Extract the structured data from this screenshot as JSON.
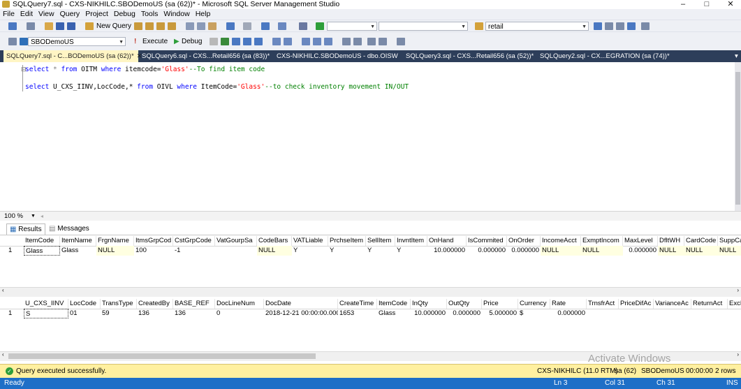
{
  "window": {
    "title": "SQLQuery7.sql - CXS-NIKHILC.SBODemoUS (sa (62))* - Microsoft SQL Server Management Studio",
    "min": "–",
    "max": "□",
    "close": "✕"
  },
  "menu": [
    "File",
    "Edit",
    "View",
    "Query",
    "Project",
    "Debug",
    "Tools",
    "Window",
    "Help"
  ],
  "toolbar1": {
    "new_query": "New Query",
    "search_value": "retail"
  },
  "toolbar2": {
    "database": "SBODemoUS",
    "execute": "Execute",
    "debug": "Debug"
  },
  "tabs": [
    {
      "label": "SQLQuery7.sql - C...BODemoUS (sa (62))*",
      "close": "✕"
    },
    {
      "label": "SQLQuery6.sql - CXS...Retail656 (sa (83))*"
    },
    {
      "label": "CXS-NIKHILC.SBODemoUS - dbo.OISW"
    },
    {
      "label": "SQLQuery3.sql - CXS...Retail656 (sa (52))*"
    },
    {
      "label": "SQLQuery2.sql - CX...EGRATION (sa (74))*"
    }
  ],
  "editor": {
    "line1": {
      "kw1": "select",
      "mid1": " * ",
      "kw2": "from",
      "mid2": " OITM ",
      "kw3": "where",
      "mid3": " itemcode=",
      "str": "'Glass'",
      "cmt": "--To find item code"
    },
    "line2": {
      "kw1": "select",
      "mid1": " U_CXS_IINV,LocCode,* ",
      "kw2": "from",
      "mid2": " OIVL ",
      "kw3": "where",
      "mid3": " ItemCode=",
      "str": "'Glass'",
      "cmt": "--to check inventory movement IN/OUT"
    }
  },
  "zoom": "100 %",
  "results_tabs": {
    "results": "Results",
    "messages": "Messages"
  },
  "grid1": {
    "columns": [
      "ItemCode",
      "ItemName",
      "FrgnName",
      "ItmsGrpCod",
      "CstGrpCode",
      "VatGourpSa",
      "CodeBars",
      "VATLiable",
      "PrchseItem",
      "SellItem",
      "InvntItem",
      "OnHand",
      "IsCommited",
      "OnOrder",
      "IncomeAcct",
      "ExmptIncom",
      "MaxLevel",
      "DfltWH",
      "CardCode",
      "SuppCatN"
    ],
    "rows": [
      [
        "Glass",
        "Glass",
        "NULL",
        "100",
        "-1",
        "",
        "NULL",
        "Y",
        "Y",
        "Y",
        "Y",
        "10.000000",
        "0.000000",
        "0.000000",
        "NULL",
        "NULL",
        "0.000000",
        "NULL",
        "NULL",
        "NULL"
      ]
    ]
  },
  "grid2": {
    "columns": [
      "U_CXS_IINV",
      "LocCode",
      "TransType",
      "CreatedBy",
      "BASE_REF",
      "DocLineNum",
      "DocDate",
      "CreateTime",
      "ItemCode",
      "InQty",
      "OutQty",
      "Price",
      "Currency",
      "Rate",
      "TrnsfrAct",
      "PriceDifAc",
      "VarianceAc",
      "ReturnAct",
      "ExcRate"
    ],
    "rows": [
      [
        "S",
        "01",
        "59",
        "136",
        "136",
        "0",
        "2018-12-21 00:00:00.000",
        "1653",
        "Glass",
        "10.000000",
        "0.000000",
        "5.000000",
        "$",
        "0.000000",
        "",
        "",
        "",
        "",
        ""
      ]
    ]
  },
  "query_status": {
    "message": "Query executed successfully.",
    "server": "CXS-NIKHILC (11.0 RTM)",
    "user": "sa (62)",
    "database": "SBODemoUS",
    "time": "00:00:00",
    "rows": "2 rows"
  },
  "watermark": "Activate Windows",
  "statusbar": {
    "ready": "Ready",
    "ln": "Ln 3",
    "col": "Col 31",
    "ch": "Ch 31",
    "ins": "INS"
  }
}
